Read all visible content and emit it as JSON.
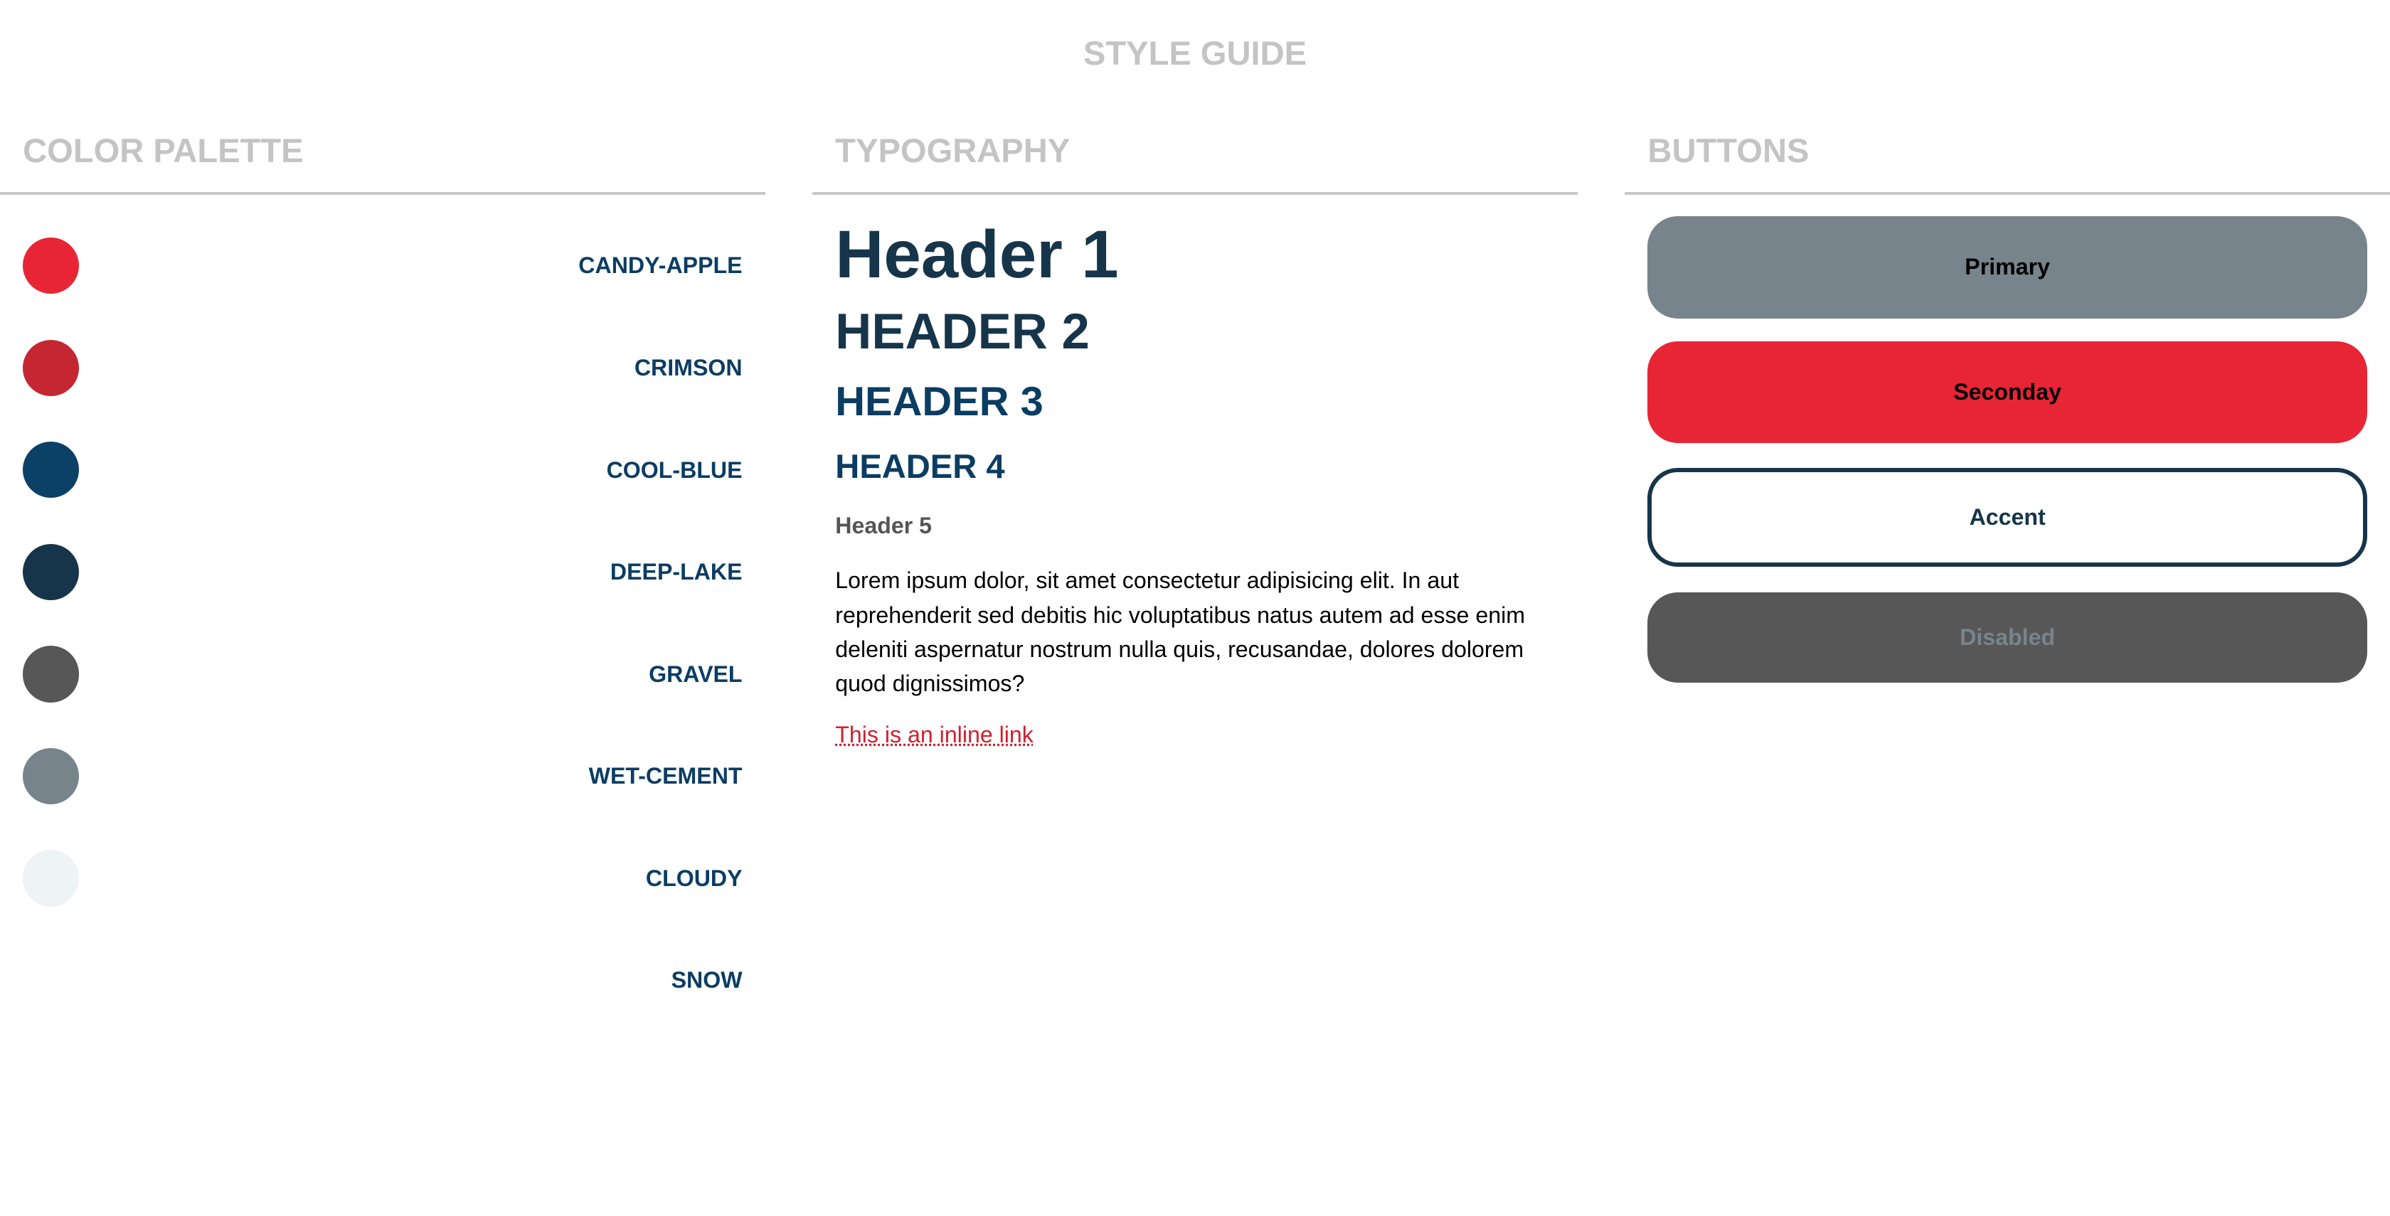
{
  "title": "STYLE GUIDE",
  "palette": {
    "heading": "COLOR PALETTE",
    "colors": [
      {
        "name": "CANDY-APPLE",
        "hex": "#e82535"
      },
      {
        "name": "CRIMSON",
        "hex": "#c42732"
      },
      {
        "name": "COOL-BLUE",
        "hex": "#0b4166"
      },
      {
        "name": "DEEP-LAKE",
        "hex": "#16354a"
      },
      {
        "name": "GRAVEL",
        "hex": "#575757"
      },
      {
        "name": "WET-CEMENT",
        "hex": "#77848c"
      },
      {
        "name": "CLOUDY",
        "hex": "#eef3f6"
      },
      {
        "name": "SNOW",
        "hex": "#ffffff"
      }
    ]
  },
  "typography": {
    "heading": "TYPOGRAPHY",
    "h1": "Header 1",
    "h2": "HEADER 2",
    "h3": "HEADER 3",
    "h4": "HEADER 4",
    "h5": "Header 5",
    "paragraph": "Lorem ipsum dolor, sit amet consectetur adipisicing elit. In aut reprehenderit sed debitis hic voluptatibus natus autem ad esse enim deleniti aspernatur nostrum nulla quis, recusandae, dolores dolorem quod dignissimos?",
    "link": "This is an inline link"
  },
  "buttons": {
    "heading": "BUTTONS",
    "primary": "Primary",
    "secondary": "Seconday",
    "accent": "Accent",
    "disabled": "Disabled"
  }
}
